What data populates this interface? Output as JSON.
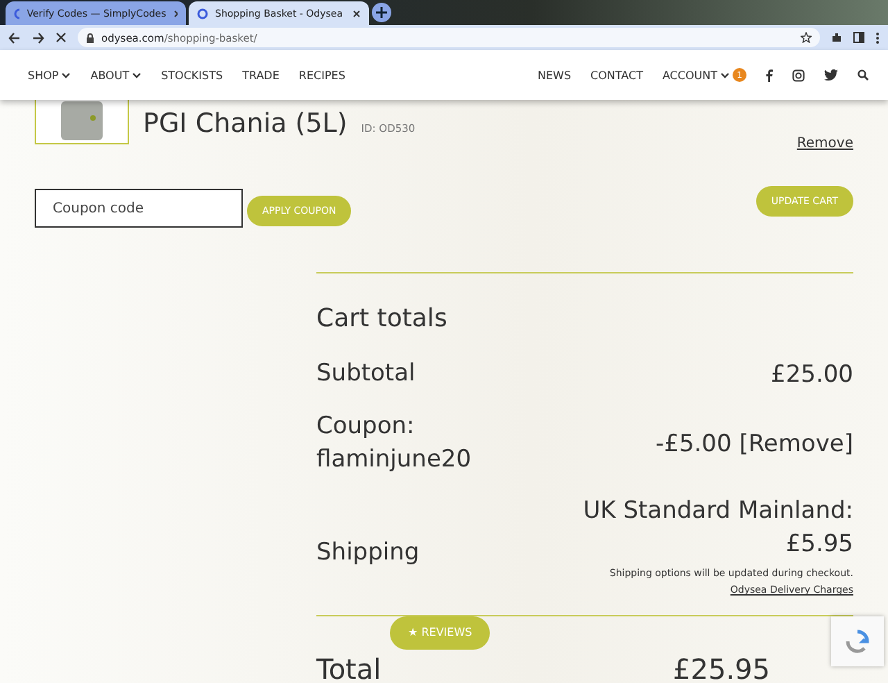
{
  "browser": {
    "tabs": [
      {
        "title": "Verify Codes — SimplyCodes",
        "selected": false
      },
      {
        "title": "Shopping Basket - Odysea",
        "selected": true
      }
    ],
    "url_host": "odysea.com",
    "url_path": "/shopping-basket/"
  },
  "nav": {
    "left": [
      {
        "label": "SHOP",
        "dropdown": true
      },
      {
        "label": "ABOUT",
        "dropdown": true
      },
      {
        "label": "STOCKISTS",
        "dropdown": false
      },
      {
        "label": "TRADE",
        "dropdown": false
      },
      {
        "label": "RECIPES",
        "dropdown": false
      }
    ],
    "right": [
      {
        "label": "NEWS",
        "dropdown": false
      },
      {
        "label": "CONTACT",
        "dropdown": false
      },
      {
        "label": "ACCOUNT",
        "dropdown": true
      }
    ],
    "account_badge": "1"
  },
  "product": {
    "name": "PGI Chania (5L)",
    "id": "ID: OD530",
    "remove": "Remove"
  },
  "coupon": {
    "placeholder": "Coupon code",
    "apply": "APPLY COUPON",
    "update": "UPDATE CART"
  },
  "totals": {
    "title": "Cart totals",
    "subtotal_label": "Subtotal",
    "subtotal": "£25.00",
    "coupon_label": "Coupon: flaminjune20",
    "coupon_value": "-£5.00",
    "coupon_remove": "[Remove]",
    "shipping_label": "Shipping",
    "shipping_method": "UK Standard Mainland: £5.95",
    "shipping_note": "Shipping options will be updated during checkout.",
    "shipping_link": "Odysea Delivery Charges",
    "total_label": "Total",
    "total_value": "£25.95"
  },
  "reviews_button": "★ REVIEWS"
}
